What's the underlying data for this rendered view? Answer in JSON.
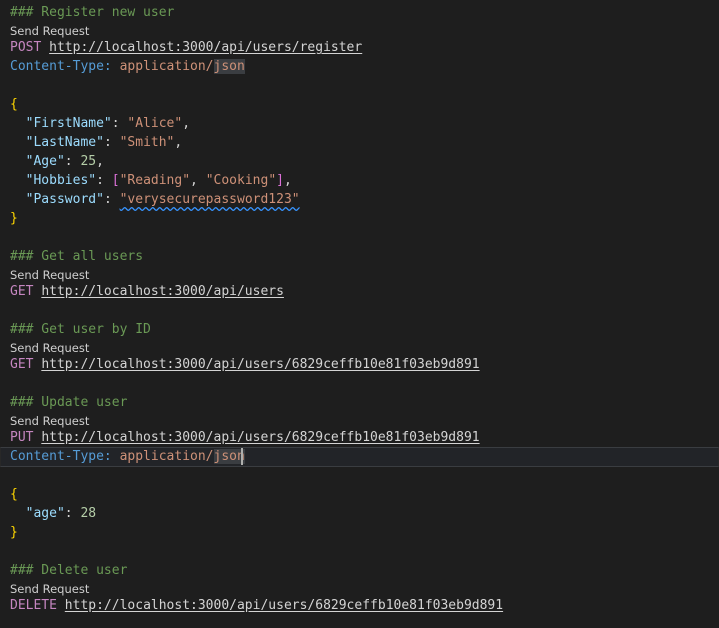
{
  "codelens_label": "Send Request",
  "requests": [
    {
      "comment": "### Register new user",
      "method": "POST",
      "url": "http://localhost:3000/api/users/register",
      "header": {
        "name": "Content-Type:",
        "value_prefix": "application/",
        "value_highlight": "json"
      },
      "body": {
        "open": "{",
        "close": "}",
        "fields": [
          {
            "key": "\"FirstName\"",
            "value": "\"Alice\"",
            "type": "string"
          },
          {
            "key": "\"LastName\"",
            "value": "\"Smith\"",
            "type": "string"
          },
          {
            "key": "\"Age\"",
            "value": "25",
            "type": "number"
          },
          {
            "key": "\"Hobbies\"",
            "type": "array",
            "items": [
              "\"Reading\"",
              "\"Cooking\""
            ]
          },
          {
            "key": "\"Password\"",
            "value": "\"verysecurepassword123\"",
            "type": "string"
          }
        ]
      }
    },
    {
      "comment": "### Get all users",
      "method": "GET",
      "url": "http://localhost:3000/api/users"
    },
    {
      "comment": "### Get user by ID",
      "method": "GET",
      "url": "http://localhost:3000/api/users/6829ceffb10e81f03eb9d891"
    },
    {
      "comment": "### Update user",
      "method": "PUT",
      "url": "http://localhost:3000/api/users/6829ceffb10e81f03eb9d891",
      "header": {
        "name": "Content-Type:",
        "value_prefix": "application/",
        "value_highlight": "json"
      },
      "body": {
        "open": "{",
        "close": "}",
        "fields": [
          {
            "key": "\"age\"",
            "value": "28",
            "type": "number"
          }
        ]
      }
    },
    {
      "comment": "### Delete user",
      "method": "DELETE",
      "url": "http://localhost:3000/api/users/6829ceffb10e81f03eb9d891"
    }
  ],
  "colors": {
    "background": "#1e1e1e",
    "comment": "#6a9955",
    "method": "#c586c0",
    "header_name": "#569cd6",
    "string": "#ce9178",
    "json_key": "#9cdcfe",
    "number": "#b5cea8",
    "brace": "#ffd700",
    "bracket": "#da70d6"
  }
}
